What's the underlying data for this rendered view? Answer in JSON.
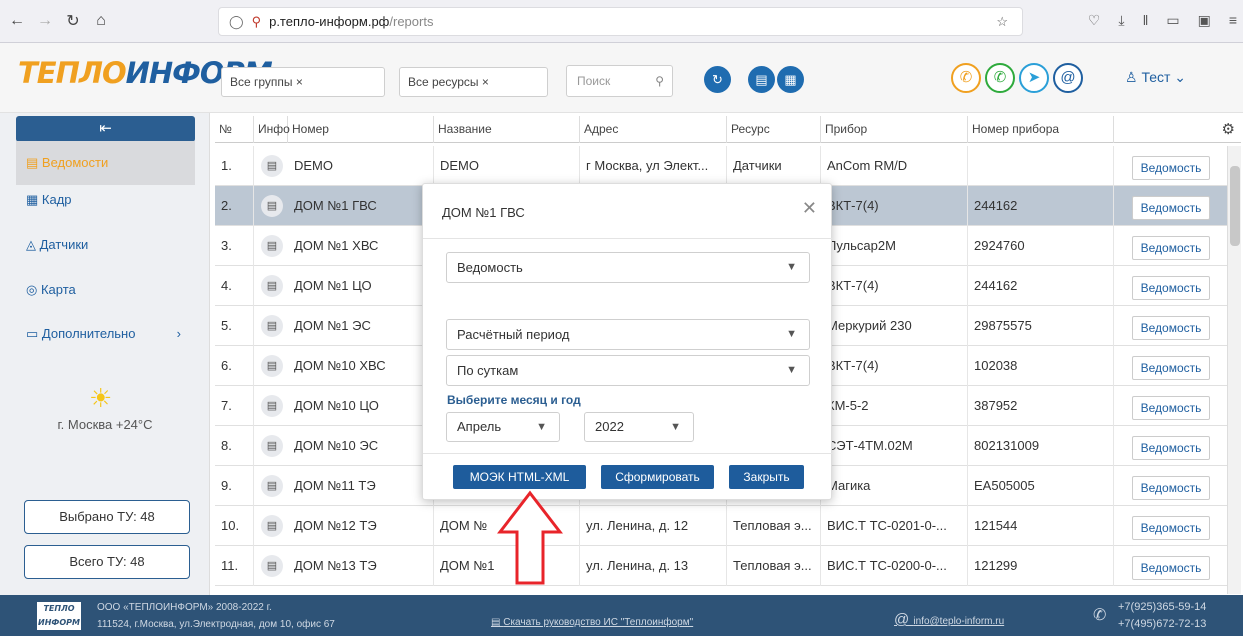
{
  "browser": {
    "url_host": "р.тепло-информ.рф",
    "url_path": "/reports"
  },
  "header": {
    "logo_part1": "ТЕПЛО",
    "logo_part2": "ИНФОРМ",
    "filter_groups": "Все группы ×",
    "filter_resources": "Все ресурсы ×",
    "search_placeholder": "Поиск",
    "user": "Тест ⌄"
  },
  "sidebar": {
    "items": [
      {
        "label": "Ведомости"
      },
      {
        "label": "Кадр"
      },
      {
        "label": "Датчики"
      },
      {
        "label": "Карта"
      },
      {
        "label": "Дополнительно"
      }
    ],
    "weather": "г. Москва +24°С",
    "selected": "Выбрано ТУ: 48",
    "total": "Всего ТУ: 48"
  },
  "table": {
    "headers": [
      "№",
      "Инфо",
      "Номер",
      "Название",
      "Адрес",
      "Ресурс",
      "Прибор",
      "Номер прибора"
    ],
    "button_label": "Ведомость",
    "rows": [
      [
        "1.",
        "DEMO",
        "DEMO",
        "г Москва, ул Элект...",
        "Датчики",
        "AnCom RM/D",
        ""
      ],
      [
        "2.",
        "ДОМ №1 ГВС",
        "",
        "",
        "",
        "ВКТ-7(4)",
        "244162"
      ],
      [
        "3.",
        "ДОМ №1 ХВС",
        "",
        "",
        "",
        "Пульсар2М",
        "2924760"
      ],
      [
        "4.",
        "ДОМ №1 ЦО",
        "",
        "",
        "",
        "ВКТ-7(4)",
        "244162"
      ],
      [
        "5.",
        "ДОМ №1 ЭС",
        "",
        "",
        "",
        "Меркурий 230",
        "29875575"
      ],
      [
        "6.",
        "ДОМ №10 ХВС",
        "",
        "",
        "",
        "ВКТ-7(4)",
        "102038"
      ],
      [
        "7.",
        "ДОМ №10 ЦО",
        "",
        "",
        "",
        "КМ-5-2",
        "387952"
      ],
      [
        "8.",
        "ДОМ №10 ЭС",
        "",
        "",
        "",
        "СЭТ-4ТМ.02М",
        "802131009"
      ],
      [
        "9.",
        "ДОМ №11 ТЭ",
        "",
        "",
        "",
        "Магика",
        "ЕА505005"
      ],
      [
        "10.",
        "ДОМ №12 ТЭ",
        "ДОМ №",
        "ул. Ленина, д. 12",
        "Тепловая э...",
        "ВИС.Т ТС-0201-0-...",
        "121544"
      ],
      [
        "11.",
        "ДОМ №13 ТЭ",
        "ДОМ №1",
        "ул. Ленина, д. 13",
        "Тепловая э...",
        "ВИС.Т ТС-0200-0-...",
        "121299"
      ]
    ]
  },
  "modal": {
    "title": "ДОМ №1 ГВС",
    "report": "Ведомость",
    "period": "Расчётный период",
    "granularity": "По суткам",
    "month_year_label": "Выберите месяц и год",
    "month": "Апрель",
    "year": "2022",
    "btn_moek": "МОЭК HTML-XML",
    "btn_generate": "Сформировать",
    "btn_close": "Закрыть"
  },
  "footer": {
    "company": "ООО «ТЕПЛОИНФОРМ» 2008-2022 г.",
    "address": "111524, г.Москва, ул.Электродная, дом 10, офис 67",
    "manual": "Скачать руководство ИС \"Теплоинформ\"",
    "email": "info@teplo-inform.ru",
    "phone1": "+7(925)365-59-14",
    "phone2": "+7(495)672-72-13"
  },
  "colors": {
    "accent": "#1f5fa0",
    "brand_orange": "#f0a020",
    "highlight": "#e8242a"
  }
}
